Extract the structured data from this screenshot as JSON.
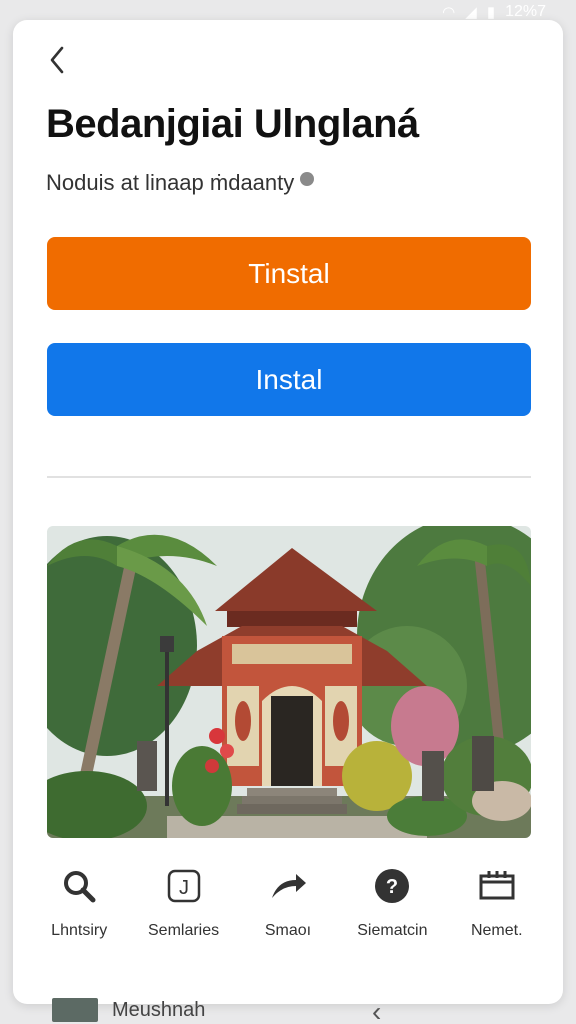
{
  "status_bar": {
    "time": "12%7"
  },
  "header": {
    "title": "Bedanjgiai Ulnglaná",
    "subtitle": "Noduis at linaap ṁdaanty"
  },
  "actions": {
    "primary_label": "Tinstal",
    "secondary_label": "Instal"
  },
  "colors": {
    "primary_button": "#f06c00",
    "secondary_button": "#1177ea"
  },
  "bottom_nav": {
    "items": [
      {
        "label": "Lhntsiry",
        "icon": "search-icon"
      },
      {
        "label": "Semlaries",
        "icon": "app-j-icon"
      },
      {
        "label": "Smaoı",
        "icon": "share-icon"
      },
      {
        "label": "Siematcin",
        "icon": "help-icon"
      },
      {
        "label": "Nemet.",
        "icon": "calendar-icon"
      }
    ]
  },
  "footer": {
    "label": "Meushnah"
  }
}
